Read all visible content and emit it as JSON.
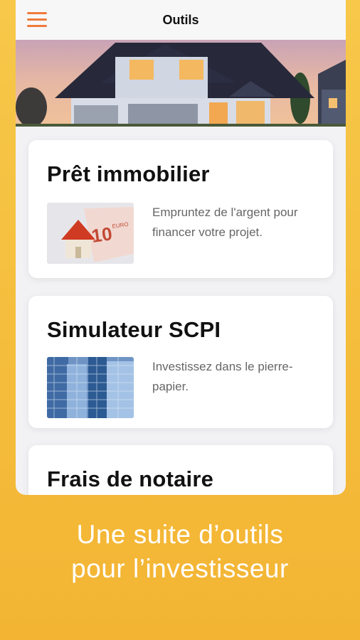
{
  "header": {
    "title": "Outils",
    "menu_icon": "hamburger-menu-icon"
  },
  "hero": {
    "image": "house-photo"
  },
  "cards": [
    {
      "title": "Prêt immobilier",
      "description": "Empruntez de l'argent pour financer votre projet.",
      "thumb": "house-euro-banknote-image"
    },
    {
      "title": "Simulateur SCPI",
      "description": "Investissez dans le pierre-papier.",
      "thumb": "office-buildings-image"
    },
    {
      "title": "Frais de notaire",
      "description": "",
      "thumb": ""
    }
  ],
  "tagline": {
    "line1": "Une suite d’outils",
    "line2": "pour l’investisseur"
  },
  "colors": {
    "background": "#f5bd3c",
    "accent": "#f07a3a",
    "card": "#ffffff",
    "text": "#111111"
  }
}
